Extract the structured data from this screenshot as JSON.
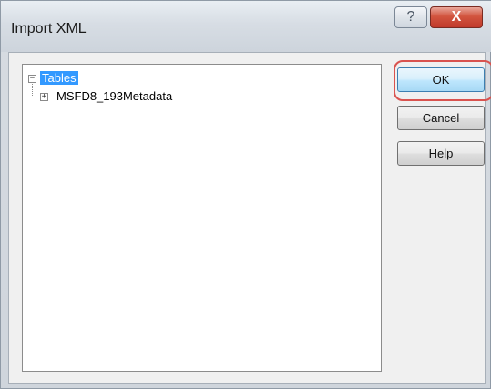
{
  "window": {
    "title": "Import XML",
    "help_glyph": "?",
    "close_glyph": "X"
  },
  "tree": {
    "root": {
      "label": "Tables",
      "expanded": true,
      "toggle_glyph": "−"
    },
    "children": [
      {
        "label": "MSFD8_193Metadata",
        "expanded": false,
        "toggle_glyph": "+"
      }
    ]
  },
  "buttons": {
    "ok": "OK",
    "cancel": "Cancel",
    "help": "Help"
  },
  "colors": {
    "selection": "#3399ff",
    "highlight_ring": "#d9534f",
    "close_button": "#c0392b"
  }
}
